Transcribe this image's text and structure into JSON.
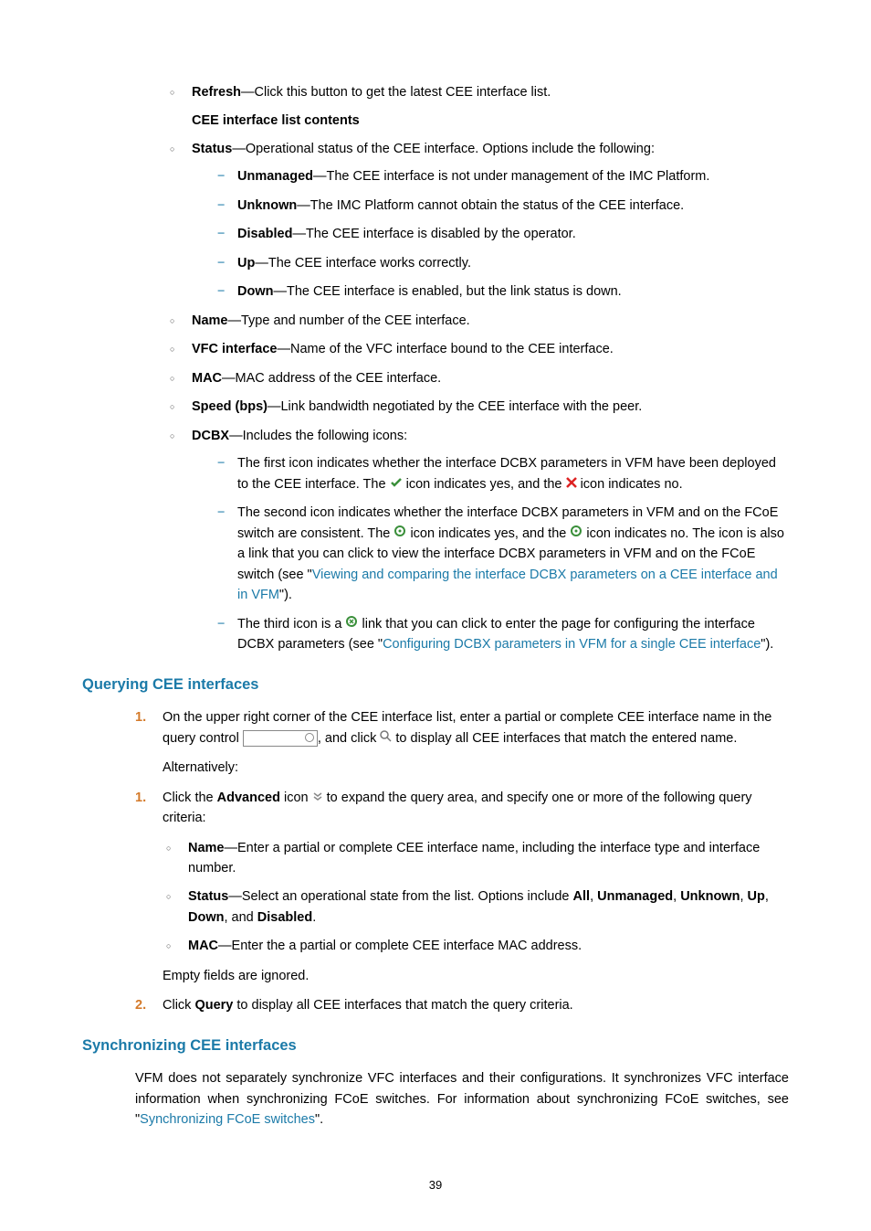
{
  "top": {
    "refresh_label": "Refresh",
    "refresh_desc": "—Click this button to get the latest CEE interface list.",
    "contents_heading": "CEE interface list contents",
    "status_label": "Status",
    "status_desc": "—Operational status of the CEE interface. Options include the following:",
    "status_opts": {
      "unmanaged_l": "Unmanaged",
      "unmanaged_d": "—The CEE interface is not under management of the IMC Platform.",
      "unknown_l": "Unknown",
      "unknown_d": "—The IMC Platform cannot obtain the status of the CEE interface.",
      "disabled_l": "Disabled",
      "disabled_d": "—The CEE interface is disabled by the operator.",
      "up_l": "Up",
      "up_d": "—The CEE interface works correctly.",
      "down_l": "Down",
      "down_d": "—The CEE interface is enabled, but the link status is down."
    },
    "name_l": "Name",
    "name_d": "—Type and number of the CEE interface.",
    "vfc_l": "VFC interface",
    "vfc_d": "—Name of the VFC interface bound to the CEE interface.",
    "mac_l": "MAC",
    "mac_d": "—MAC address of the CEE interface.",
    "speed_l": "Speed (bps)",
    "speed_d": "—Link bandwidth negotiated by the CEE interface with the peer.",
    "dcbx_l": "DCBX",
    "dcbx_d": "—Includes the following icons:",
    "dcbx1a": "The first icon indicates whether the interface DCBX parameters in VFM have been deployed to the CEE interface. The ",
    "dcbx1b": " icon indicates yes, and the ",
    "dcbx1c": " icon indicates no.",
    "dcbx2a": "The second icon indicates whether the interface DCBX parameters in VFM and on the FCoE switch are consistent. The ",
    "dcbx2b": " icon indicates yes, and the ",
    "dcbx2c": " icon indicates no. The icon is also a link that you can click to view the interface DCBX parameters in VFM and on the FCoE switch (see \"",
    "dcbx2link": "Viewing and comparing the interface DCBX parameters on a CEE interface and in VFM",
    "dcbx2d": "\").",
    "dcbx3a": "The third icon is a ",
    "dcbx3b": " link that you can click to enter the page for configuring the interface DCBX parameters (see \"",
    "dcbx3link": "Configuring DCBX parameters in VFM for a single CEE interface",
    "dcbx3c": "\")."
  },
  "query": {
    "heading": "Querying CEE interfaces",
    "step1a": "On the upper right corner of the CEE interface list, enter a partial or complete CEE interface name in the query control ",
    "step1b": ", and click ",
    "step1c": " to display all CEE interfaces that match the entered name.",
    "alt": "Alternatively:",
    "adv1a": "Click the ",
    "adv1_b": "Advanced",
    "adv1b": " icon ",
    "adv1c": " to expand the query area, and specify one or more of the following query criteria:",
    "name_l": "Name",
    "name_d": "—Enter a partial or complete CEE interface name, including the interface type and interface number.",
    "status_l": "Status",
    "status_d1": "—Select an operational state from the list. Options include ",
    "all": "All",
    "unmanaged": "Unmanaged",
    "unknown": "Unknown",
    "up": "Up",
    "down": "Down",
    "and": ", and ",
    "disabled": "Disabled",
    "dot": ".",
    "mac_l": "MAC",
    "mac_d": "—Enter the a partial or complete CEE interface MAC address.",
    "empty": "Empty fields are ignored.",
    "step2a": "Click ",
    "step2b": "Query",
    "step2c": " to display all CEE interfaces that match the query criteria."
  },
  "sync": {
    "heading": "Synchronizing CEE interfaces",
    "p1": "VFM does not separately synchronize VFC interfaces and their configurations. It synchronizes VFC interface information when synchronizing FCoE switches. For information about synchronizing FCoE switches, see \"",
    "link": "Synchronizing FCoE switches",
    "p2": "\"."
  },
  "page": "39"
}
